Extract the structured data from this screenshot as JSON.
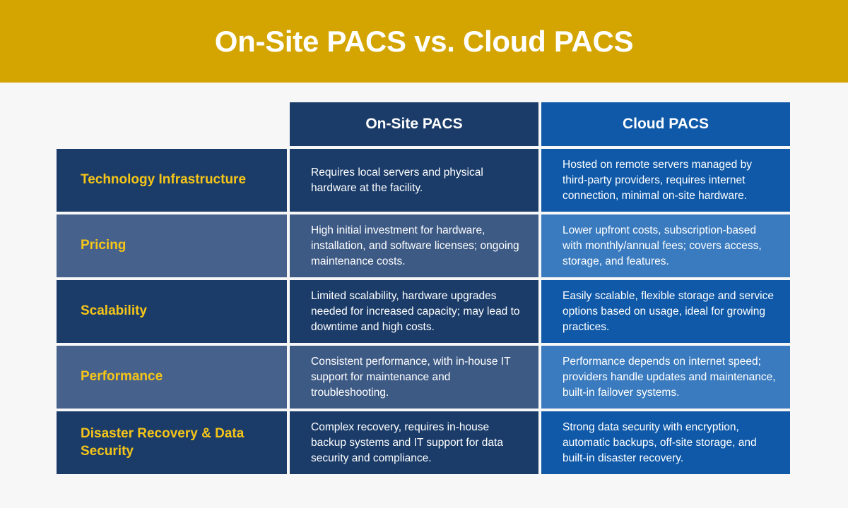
{
  "banner": {
    "title": "On-Site PACS vs. Cloud PACS"
  },
  "table": {
    "headers": {
      "label_column": "",
      "onsite": "On-Site PACS",
      "cloud": "Cloud PACS"
    },
    "rows": [
      {
        "label": "Technology Infrastructure",
        "onsite": "Requires local servers and physical hardware at the facility.",
        "cloud": "Hosted on remote servers managed by third-party providers, requires internet connection, minimal on-site hardware."
      },
      {
        "label": "Pricing",
        "onsite": "High initial investment for hardware, installation, and software licenses; ongoing maintenance costs.",
        "cloud": "Lower upfront costs, subscription-based with monthly/annual fees; covers access, storage, and features."
      },
      {
        "label": "Scalability",
        "onsite": "Limited scalability, hardware upgrades needed for increased capacity; may lead to downtime and high costs.",
        "cloud": "Easily scalable, flexible storage and service options based on usage, ideal for growing practices."
      },
      {
        "label": "Performance",
        "onsite": "Consistent performance, with in-house IT support for maintenance and troubleshooting.",
        "cloud": "Performance depends on internet speed; providers handle updates and maintenance, built-in failover systems."
      },
      {
        "label": "Disaster Recovery & Data Security",
        "onsite": "Complex recovery, requires in-house backup systems and IT support for data security and compliance.",
        "cloud": "Strong data security with encryption, automatic backups, off-site storage, and built-in disaster recovery."
      }
    ]
  },
  "colors": {
    "banner_gold": "#d4a500",
    "page_background": "#f7f7f7",
    "navy_dark": "#1b3c69",
    "navy_light": "#46618c",
    "onsite_light": "#3d5a85",
    "cloud_dark": "#0f59a8",
    "cloud_light": "#3a7bbf",
    "label_text_gold": "#f5c518",
    "body_text_white": "#ffffff"
  }
}
